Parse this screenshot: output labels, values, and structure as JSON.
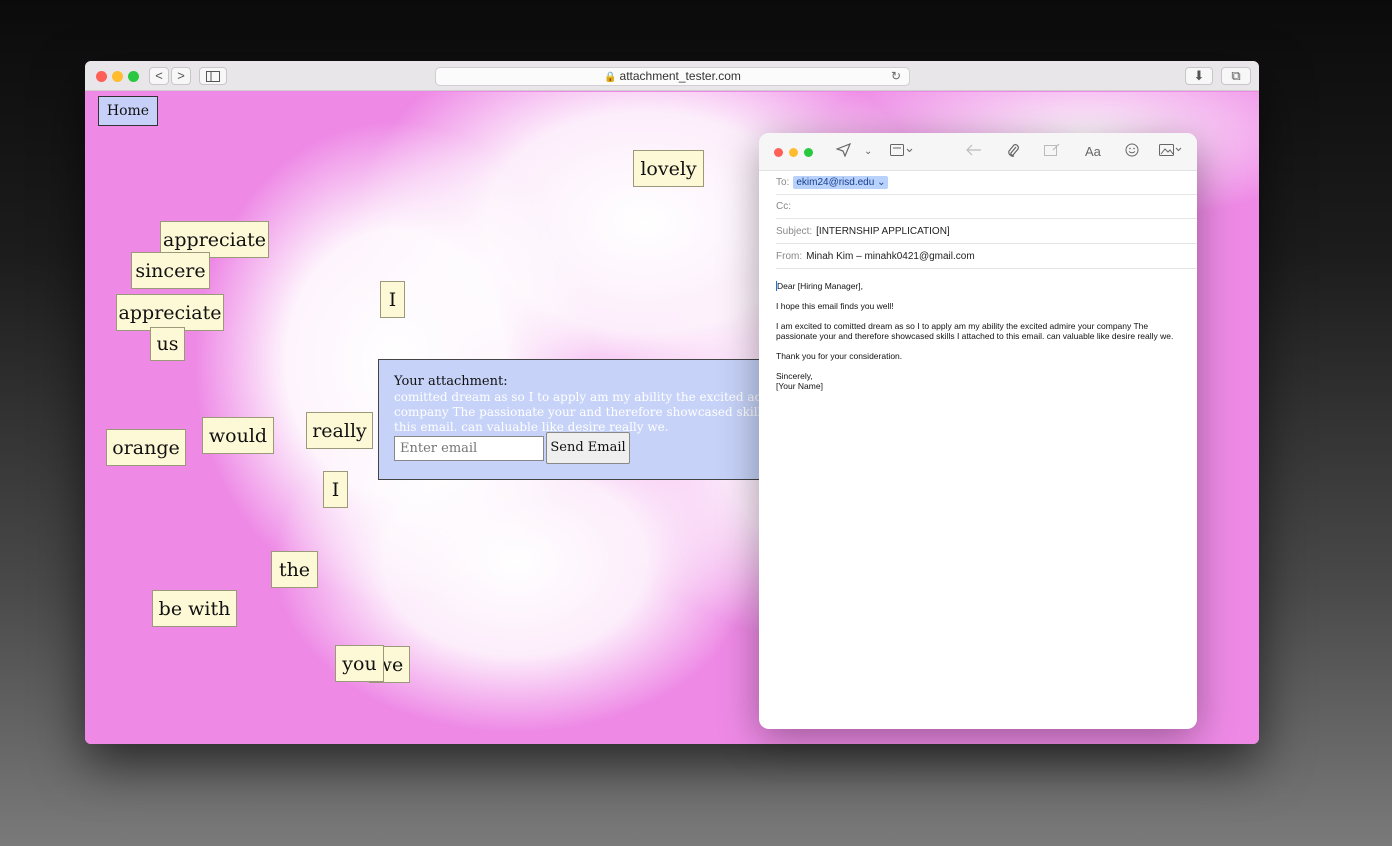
{
  "browser": {
    "url": "attachment_tester.com",
    "nav_back": "<",
    "nav_forward": ">",
    "reload": "↻",
    "download": "⬇",
    "tabs": "⧉"
  },
  "page": {
    "home_label": "Home",
    "words": [
      {
        "text": "lovely"
      },
      {
        "text": "appreciate"
      },
      {
        "text": "sincere"
      },
      {
        "text": "appreciate"
      },
      {
        "text": "us"
      },
      {
        "text": "I"
      },
      {
        "text": "orange"
      },
      {
        "text": "would"
      },
      {
        "text": "really"
      },
      {
        "text": "I"
      },
      {
        "text": "the"
      },
      {
        "text": "be with"
      },
      {
        "text": "we"
      },
      {
        "text": "you"
      }
    ],
    "attachment": {
      "title": "Your attachment:",
      "text": "comitted dream as so I to apply am my ability the excited admire your company The passionate your and therefore showcased skills I attached to this email. can valuable like desire really we.",
      "email_placeholder": "Enter email",
      "send_label": "Send Email"
    }
  },
  "mail": {
    "to_label": "To:",
    "to_value": "ekim24@risd.edu",
    "cc_label": "Cc:",
    "subject_label": "Subject:",
    "subject_value": "[INTERNSHIP APPLICATION]",
    "from_label": "From:",
    "from_value": "Minah Kim – minahk0421@gmail.com",
    "body": {
      "greeting": "Dear [Hiring Manager],",
      "line1": "I hope this email finds you well!",
      "line2": "I am excited to comitted dream as so I to apply am my ability the excited admire your company The passionate your and therefore showcased skills I attached to this email. can valuable like desire really we.",
      "line3": "Thank you for your consideration.",
      "closing": "Sincerely,",
      "signature": "[Your Name]"
    },
    "toolbar": {
      "font_label": "Aa"
    }
  }
}
